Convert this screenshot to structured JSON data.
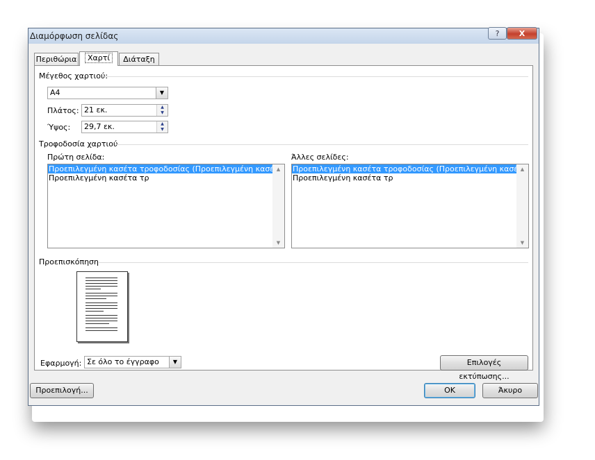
{
  "window": {
    "title": "Διαμόρφωση σελίδας",
    "help_label": "?",
    "close_label": "X"
  },
  "tabs": [
    {
      "label": "Περιθώρια",
      "active": false
    },
    {
      "label": "Χαρτί",
      "active": true
    },
    {
      "label": "Διάταξη",
      "active": false
    }
  ],
  "paper_size": {
    "group_label": "Μέγεθος χαρτιού:",
    "selected": "A4",
    "width_label": "Πλάτος:",
    "width_value": "21 εκ.",
    "height_label": "Ύψος:",
    "height_value": "29,7 εκ."
  },
  "paper_source": {
    "group_label": "Τροφοδοσία χαρτιού",
    "first_page_label": "Πρώτη σελίδα:",
    "other_pages_label": "Άλλες σελίδες:",
    "first_page_items": [
      "Προεπιλεγμένη κασέτα τροφοδοσίας (Προεπιλεγμένη κασέτα τρ)",
      "Προεπιλεγμένη κασέτα τρ"
    ],
    "other_pages_items": [
      "Προεπιλεγμένη κασέτα τροφοδοσίας (Προεπιλεγμένη κασέτα τρ)",
      "Προεπιλεγμένη κασέτα τρ"
    ]
  },
  "preview": {
    "group_label": "Προεπισκόπηση"
  },
  "apply_to": {
    "label": "Εφαρμογή:",
    "selected": "Σε όλο το έγγραφο"
  },
  "buttons": {
    "print_options": "Επιλογές εκτύπωσης...",
    "default": "Προεπιλογή...",
    "ok": "OK",
    "cancel": "Άκυρο"
  },
  "colors": {
    "selection": "#3399ff",
    "dialog_bg": "#f0f0f0",
    "titlebar": "#c4d5ea"
  }
}
